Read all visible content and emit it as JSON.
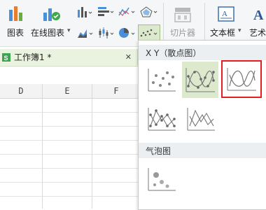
{
  "ribbon": {
    "chart_label": "图表",
    "online_chart_label": "在线图表",
    "online_chart_arrow": "▾",
    "slicer_label": "切片器",
    "textbox_label": "文本框",
    "textbox_arrow": "▾",
    "art_label": "艺术"
  },
  "workbook_tab": {
    "title": "工作簿1 *",
    "close": "✕"
  },
  "grid": {
    "columns": [
      "D",
      "E",
      "F"
    ]
  },
  "scatter_menu": {
    "xy_section": "X Y（散点图）",
    "bubble_section": "气泡图",
    "options": [
      "scatter",
      "scatter-smooth-markers",
      "scatter-smooth-lines",
      "scatter-straight-markers",
      "scatter-straight-lines"
    ],
    "bubble_options": [
      "bubble"
    ],
    "highlight_color": "#e02020",
    "selected_bg": "#dde9cd"
  }
}
